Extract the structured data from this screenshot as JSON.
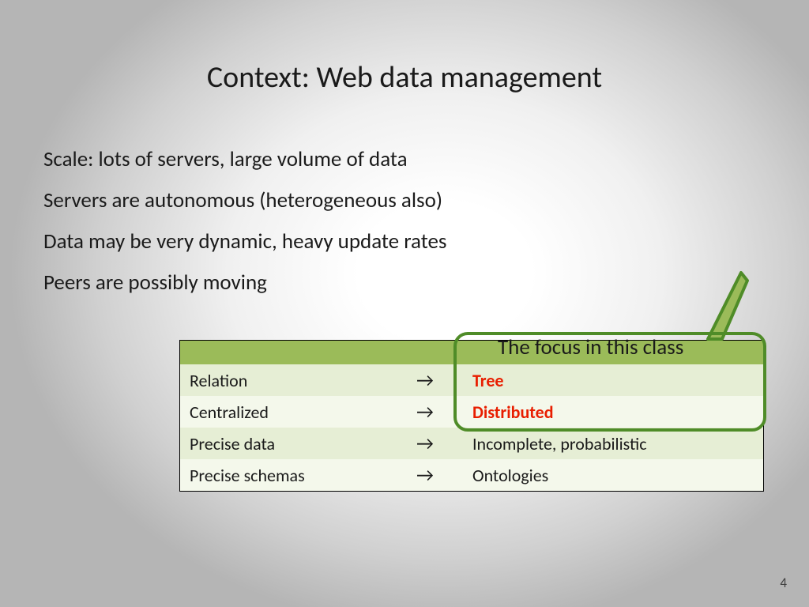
{
  "title": "Context: Web data management",
  "bullets": [
    "Scale: lots of servers, large volume of data",
    "Servers are autonomous (heterogeneous also)",
    "Data may be very dynamic, heavy update rates",
    "Peers are possibly moving"
  ],
  "table": {
    "rows": [
      {
        "from": "Relation",
        "arrow": "→",
        "to": "Tree",
        "highlight": true
      },
      {
        "from": "Centralized",
        "arrow": "→",
        "to": "Distributed",
        "highlight": true
      },
      {
        "from": "Precise data",
        "arrow": "→",
        "to": "Incomplete, probabilistic",
        "highlight": false
      },
      {
        "from": "Precise  schemas",
        "arrow": "→",
        "to": "Ontologies",
        "highlight": false
      }
    ]
  },
  "callout": {
    "label": "The focus in this class"
  },
  "pageNumber": "4"
}
